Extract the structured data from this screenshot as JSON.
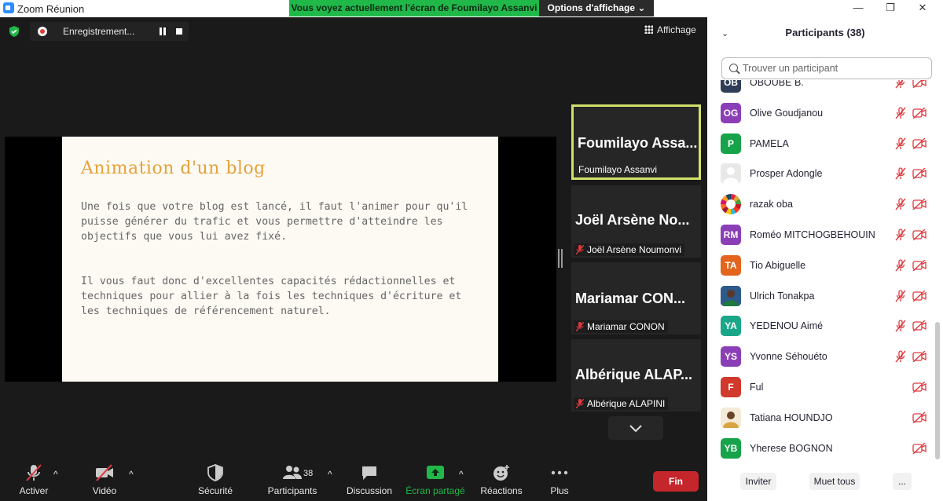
{
  "window": {
    "title": "Zoom Réunion"
  },
  "share_banner": {
    "text": "Vous voyez actuellement l'écran de Foumilayo Assanvi",
    "view_options": "Options d'affichage ⌄"
  },
  "recording": {
    "label": "Enregistrement..."
  },
  "view_menu": {
    "label": "Affichage"
  },
  "slide": {
    "title": "Animation d'un blog",
    "paragraph1": "Une fois que votre blog est lancé, il faut l'animer pour qu'il puisse générer du trafic et vous permettre d'atteindre les objectifs que vous lui avez fixé.",
    "paragraph2": "Il vous faut donc d'excellentes capacités rédactionnelles et techniques pour allier à la fois les techniques d'écriture et les techniques de référencement naturel."
  },
  "video_tiles": [
    {
      "display": "Foumilayo Assa...",
      "name": "Foumilayo Assanvi",
      "muted": false,
      "active_speaker": true
    },
    {
      "display": "Joël Arsène No...",
      "name": "Joël Arsène Noumonvi",
      "muted": true
    },
    {
      "display": "Mariamar CON...",
      "name": "Mariamar CONON",
      "muted": true
    },
    {
      "display": "Albérique ALAP...",
      "name": "Albérique ALAPINI",
      "muted": true
    }
  ],
  "toolbar": {
    "audio": "Activer",
    "video": "Vidéo",
    "security": "Sécurité",
    "participants": "Participants",
    "participants_count": "38",
    "chat": "Discussion",
    "share": "Écran partagé",
    "reactions": "Réactions",
    "more": "Plus",
    "end": "Fin"
  },
  "panel": {
    "title": "Participants (38)",
    "search_placeholder": "Trouver un participant",
    "participants": [
      {
        "initials": "OB",
        "name": "OBOUBE B.",
        "color": "#2f3d57",
        "mic_muted": true,
        "partial": true
      },
      {
        "initials": "OG",
        "name": "Olive Goudjanou",
        "color": "#8b3fb6",
        "mic_muted": true
      },
      {
        "initials": "P",
        "name": "PAMELA",
        "color": "#17a34a",
        "mic_muted": true
      },
      {
        "initials": "",
        "name": "Prosper Adongle",
        "color": "#e4e4e4",
        "mic_muted": true,
        "photo": "blank"
      },
      {
        "initials": "",
        "name": "razak oba",
        "color": "#ffffff",
        "mic_muted": true,
        "photo": "sdg-wheel"
      },
      {
        "initials": "RM",
        "name": "Roméo MITCHOGBEHOUIN",
        "color": "#8b3fb6",
        "mic_muted": true
      },
      {
        "initials": "TA",
        "name": "Tio Abiguelle",
        "color": "#e3641d",
        "mic_muted": true
      },
      {
        "initials": "",
        "name": "Ulrich Tonakpa",
        "color": "#3a6fa3",
        "mic_muted": true,
        "photo": "person"
      },
      {
        "initials": "YA",
        "name": "YEDENOU Aimé",
        "color": "#1aa789",
        "mic_muted": true
      },
      {
        "initials": "YS",
        "name": "Yvonne Séhouéto",
        "color": "#8b3fb6",
        "mic_muted": true
      },
      {
        "initials": "F",
        "name": "Ful",
        "color": "#d0392b",
        "mic_muted": false
      },
      {
        "initials": "",
        "name": "Tatiana HOUNDJO",
        "color": "#f2e3c8",
        "mic_muted": false,
        "photo": "person-light"
      },
      {
        "initials": "YB",
        "name": "Yherese BOGNON",
        "color": "#17a34a",
        "mic_muted": false
      }
    ],
    "invite": "Inviter",
    "mute_all": "Muet tous",
    "more": "..."
  },
  "colors": {
    "accent_green": "#21b84a",
    "end_red": "#c4262c",
    "muted_red": "#e0393e",
    "speaker_border": "#d2e06a"
  }
}
